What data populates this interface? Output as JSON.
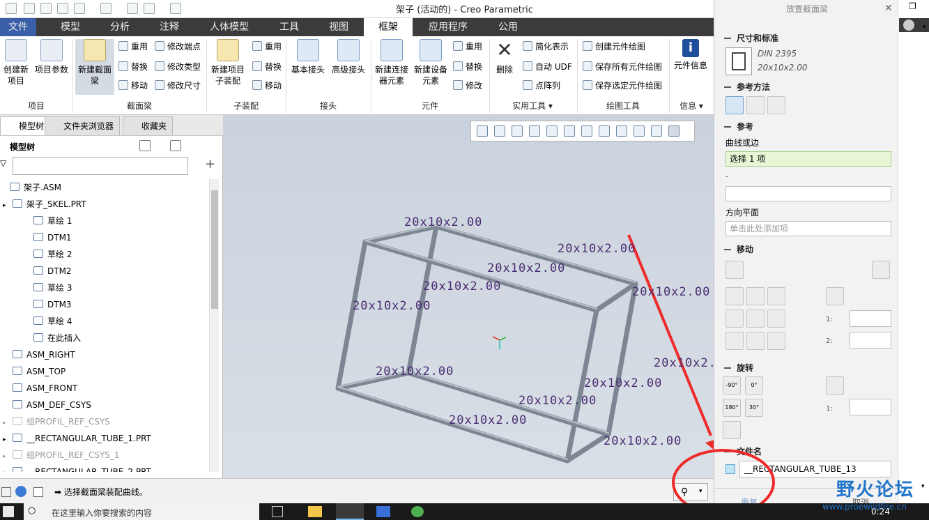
{
  "window": {
    "title": "架子 (活动的) - Creo Parametric"
  },
  "menu": {
    "tabs": [
      "文件",
      "模型",
      "分析",
      "注释",
      "人体模型",
      "工具",
      "视图",
      "框架",
      "应用程序",
      "公用"
    ],
    "active_tab": "框架"
  },
  "ribbon": {
    "groups": {
      "project": "项目",
      "beam": "截面梁",
      "subassembly": "子装配",
      "joint": "接头",
      "component": "元件",
      "utility": "实用工具",
      "drawing": "绘图工具",
      "info": "信息"
    },
    "buttons": {
      "new_project": "创建新项目",
      "project_params": "项目参数",
      "new_beam": "新建截面梁",
      "reuse1": "重用",
      "replace1": "替换",
      "move1": "移动",
      "modify_end": "修改端点",
      "modify_type": "修改类型",
      "modify_size": "修改尺寸",
      "new_sub": "新建项目子装配",
      "reuse2": "重用",
      "replace2": "替换",
      "move2": "移动",
      "basic_joint": "基本接头",
      "advanced_joint": "高级接头",
      "new_connector": "新建连接器元素",
      "new_device": "新建设备元素",
      "reuse3": "重用",
      "replace3": "替换",
      "modify3": "修改",
      "delete": "删除",
      "simplify": "简化表示",
      "auto_udf": "自动 UDF",
      "point_array": "点阵列",
      "create_drawing": "创建元件绘图",
      "save_all_drawings": "保存所有元件绘图",
      "save_selected_drawings": "保存选定元件绘图",
      "component_info": "元件信息"
    }
  },
  "left_panel": {
    "tabs": [
      "模型树",
      "文件夹浏览器",
      "收藏夹"
    ],
    "header": "模型树",
    "filter_placeholder": "",
    "tree": [
      {
        "label": "架子.ASM",
        "indent": 0,
        "dim": false
      },
      {
        "label": "架子_SKEL.PRT",
        "indent": 1,
        "dim": false
      },
      {
        "label": "草绘 1",
        "indent": 2,
        "dim": false
      },
      {
        "label": "DTM1",
        "indent": 2,
        "dim": false
      },
      {
        "label": "草绘 2",
        "indent": 2,
        "dim": false
      },
      {
        "label": "DTM2",
        "indent": 2,
        "dim": false
      },
      {
        "label": "草绘 3",
        "indent": 2,
        "dim": false
      },
      {
        "label": "DTM3",
        "indent": 2,
        "dim": false
      },
      {
        "label": "草绘 4",
        "indent": 2,
        "dim": false
      },
      {
        "label": "在此插入",
        "indent": 2,
        "dim": false
      },
      {
        "label": "ASM_RIGHT",
        "indent": 1,
        "dim": false
      },
      {
        "label": "ASM_TOP",
        "indent": 1,
        "dim": false
      },
      {
        "label": "ASM_FRONT",
        "indent": 1,
        "dim": false
      },
      {
        "label": "ASM_DEF_CSYS",
        "indent": 1,
        "dim": false
      },
      {
        "label": "组PROFIL_REF_CSYS",
        "indent": 1,
        "dim": true
      },
      {
        "label": "__RECTANGULAR_TUBE_1.PRT",
        "indent": 1,
        "dim": false
      },
      {
        "label": "组PROFIL_REF_CSYS_1",
        "indent": 1,
        "dim": true
      },
      {
        "label": "__RECTANGULAR_TUBE_2.PRT",
        "indent": 1,
        "dim": false
      }
    ]
  },
  "viewport": {
    "dimension_label": "20x10x2.00"
  },
  "right_panel": {
    "title": "放置截面梁",
    "size_section": "尺寸和标准",
    "standard": "DIN 2395",
    "profile": "20x10x2.00",
    "ref_method_section": "参考方法",
    "ref_section": "参考",
    "curve_label": "曲线或边",
    "curve_value": "选择 1 项",
    "dash": "-",
    "dir_plane_label": "方向平面",
    "dir_plane_placeholder": "单击此处添加项",
    "move_section": "移动",
    "l1": "1:",
    "l2": "2:",
    "rotate_section": "旋转",
    "rot_l1": "1:",
    "rot_btns": [
      "-90°",
      "0°",
      "180°",
      "30°"
    ],
    "filename_section": "文件名",
    "filename": "__RECTANGULAR_TUBE_13",
    "bottom_left": "重复",
    "bottom_right": "取消"
  },
  "status": {
    "message": "选择截面梁装配曲线。"
  },
  "taskbar": {
    "search": "在这里输入你要搜索的内容",
    "time": "0:24"
  },
  "watermark": {
    "text": "野火论坛",
    "url": "www.proewildfire.cn"
  }
}
